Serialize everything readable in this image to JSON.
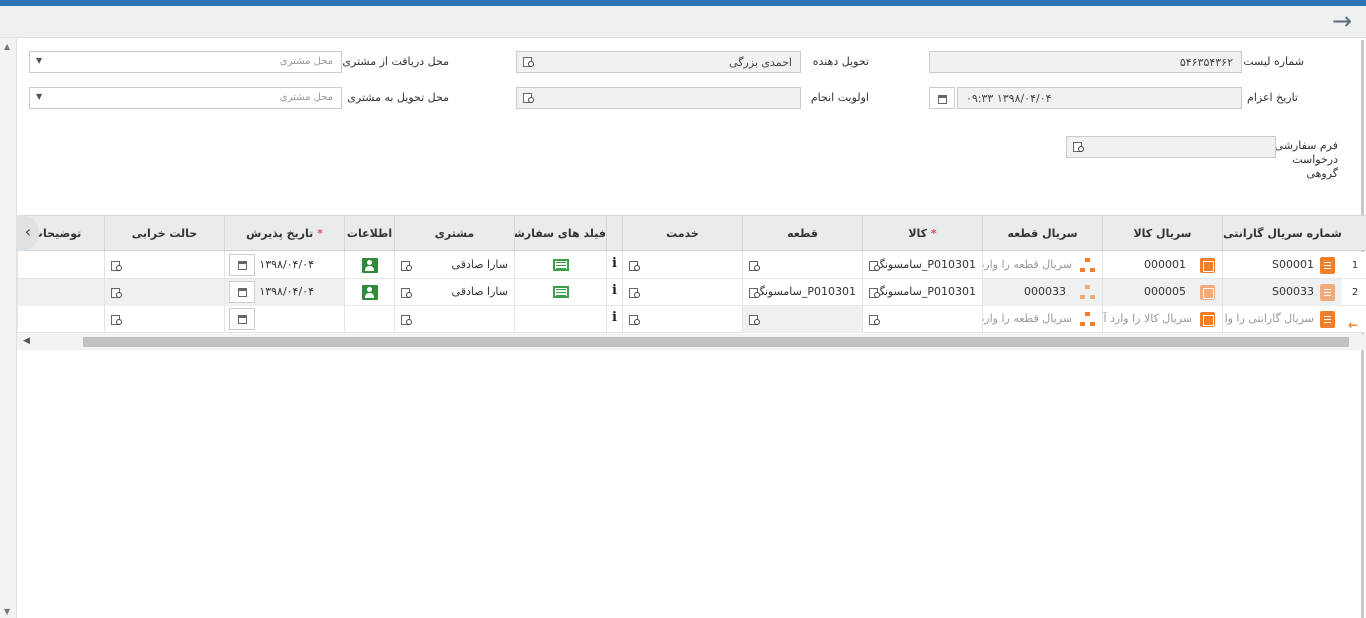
{
  "form": {
    "list_number_label": "شماره لیست",
    "list_number_value": "۵۴۶۳۵۴۳۶۲",
    "deliverer_label": "تحویل دهنده",
    "deliverer_value": "احمدی بزرگی",
    "pickup_label": "محل دریافت از مشتری",
    "pickup_placeholder": "محل مشتری",
    "dispatch_date_label": "تاریخ اعزام",
    "dispatch_date_value": "۱۳۹۸/۰۴/۰۴ ۰۹:۳۳",
    "priority_label": "اولویت انجام",
    "dropoff_label": "محل تحویل به مشتری",
    "dropoff_placeholder": "محل مشتری",
    "custom_form_label_1": "فرم سفارشی",
    "custom_form_label_2": "درخواست",
    "custom_form_label_3": "گروهی"
  },
  "grid": {
    "headers": {
      "warranty_serial": "شماره سریال گارانتی",
      "goods_serial": "سریال کالا",
      "part_serial": "سریال قطعه",
      "goods": "کالا",
      "part": "قطعه",
      "service": "خدمت",
      "custom_fields": "فیلد های سفارشی",
      "customer": "مشتری",
      "info": "اطلاعات",
      "accept_date": "تاریخ پذیرش",
      "fault_state": "حالت خرابی",
      "description": "توضیحات",
      "required_mark": "*"
    },
    "rows": [
      {
        "num": "1",
        "warranty_serial": "S00001",
        "goods_serial": "000001",
        "part_serial_placeholder": "سریال قطعه را وارد",
        "goods": "P010301_سامسونگ",
        "part": "",
        "customer": "سارا صادقی",
        "accept_date": "۱۳۹۸/۰۴/۰۴"
      },
      {
        "num": "2",
        "warranty_serial": "S00033",
        "goods_serial": "000005",
        "part_serial": "000033",
        "goods": "P010301_سامسونگ",
        "part": "P010301_سامسونگ",
        "customer": "سارا صادقی",
        "accept_date": "۱۳۹۸/۰۴/۰۴"
      }
    ],
    "new_row": {
      "warranty_placeholder": "سریال گارانتی را وا",
      "goods_placeholder": "سریال کالا را وارد آ",
      "part_placeholder": "سریال قطعه را وارد"
    }
  }
}
